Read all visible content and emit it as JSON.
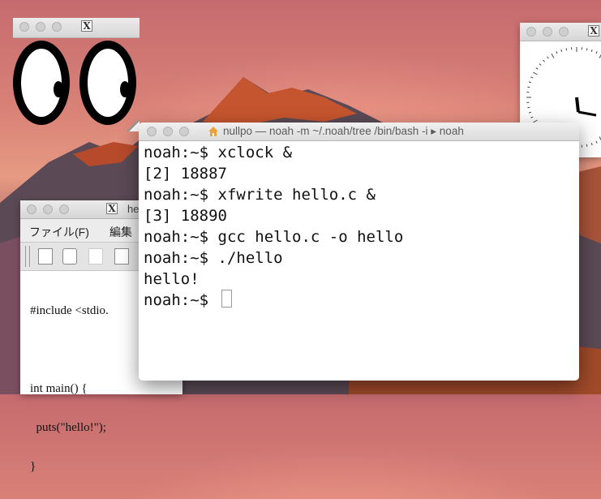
{
  "xeyes": {
    "title_icon": "X"
  },
  "xclock": {},
  "xfwrite": {
    "title_icon": "X",
    "title": "he",
    "menu": [
      "ファイル(F)",
      "編集"
    ],
    "code_lines": [
      "#include <stdio.",
      "",
      "int main() {",
      "  puts(\"hello!\");",
      "}"
    ]
  },
  "terminal": {
    "title": "nullpo — noah -m ~/.noah/tree /bin/bash -i ▸ noah",
    "lines": [
      "noah:~$ xclock &",
      "[2] 18887",
      "noah:~$ xfwrite hello.c &",
      "[3] 18890",
      "noah:~$ gcc hello.c -o hello",
      "noah:~$ ./hello",
      "hello!",
      "noah:~$ "
    ]
  },
  "icons": [
    "house-icon",
    "x-window-icon",
    "new-file-icon",
    "print-icon",
    "paste-icon"
  ]
}
